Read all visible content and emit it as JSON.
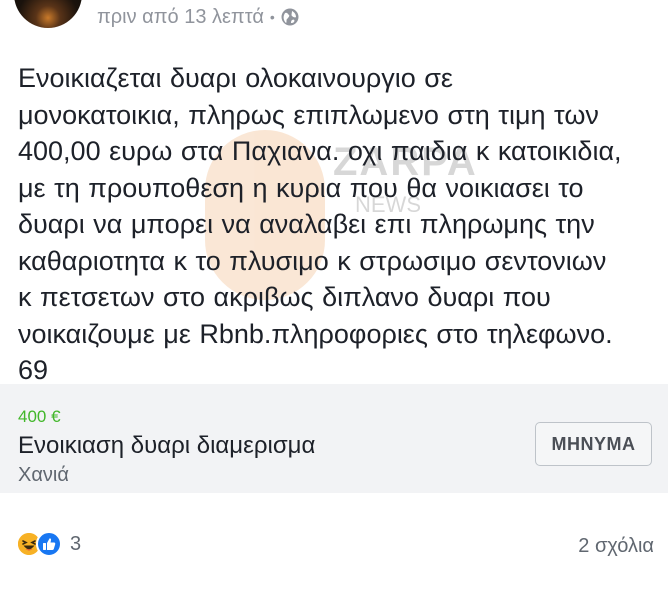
{
  "post": {
    "time": "πριν από 13 λεπτά",
    "separator": "•",
    "privacy_icon": "globe-icon",
    "body_lines": [
      "Ενοικιαζεται δυαρι ολοκαινουργιο σε",
      "μονοκατοικια, πληρως επιπλωμενο στη τιμη των",
      "400,00 ευρω στα Παχιανα. οχι παιδια κ κατοικιδια,",
      "με τη προυποθεση η κυρια που θα νοικιασει το",
      "δυαρι να μπορει να αναλαβει επι πληρωμης την",
      "καθαριοτητα κ το πλυσιμο κ στρωσιμο σεντονιων",
      "κ πετσετων στο ακριβως διπλανο δυαρι που",
      "νοικαιζουμε με Rbnb.πληροφοριες στο τηλεφωνο.",
      "69"
    ]
  },
  "watermark": {
    "text": "ZARPA",
    "sub": "NEWS"
  },
  "listing": {
    "price": "400 €",
    "title": "Ενοικιαση δυαρι διαμερισμα",
    "location": "Χανιά",
    "message_button": "ΜΗΝΥΜΑ"
  },
  "footer": {
    "reaction_icons": [
      "haha-icon",
      "like-icon"
    ],
    "reaction_count": "3",
    "comments": "2 σχόλια"
  },
  "colors": {
    "text": "#1d2129",
    "meta": "#90949c",
    "price": "#42b72a",
    "like": "#1877f2",
    "haha": "#f7b125",
    "card_bg": "#f2f3f5"
  }
}
